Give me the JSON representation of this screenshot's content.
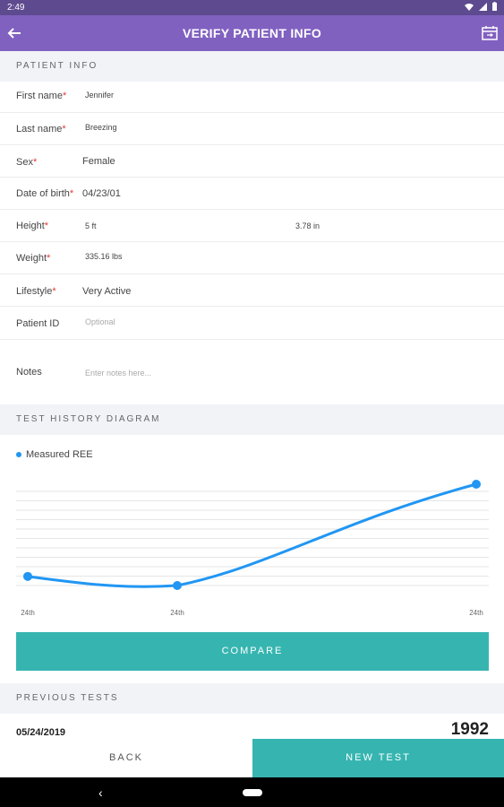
{
  "status_bar": {
    "time": "2:49",
    "wifi_icon": "wifi-icon",
    "battery_icon": "battery-icon"
  },
  "app_bar": {
    "title": "VERIFY PATIENT INFO",
    "back_icon": "back-arrow-icon",
    "calendar_icon": "calendar-icon",
    "color": "#8161c0"
  },
  "patient_info": {
    "header": "PATIENT INFO",
    "first_name": {
      "label": "First name",
      "required": "*",
      "value": "Jennifer"
    },
    "last_name": {
      "label": "Last name",
      "required": "*",
      "value": "Breezing"
    },
    "sex": {
      "label": "Sex",
      "required": "*",
      "value": "Female"
    },
    "dob": {
      "label": "Date of birth",
      "required": "*",
      "value": "04/23/01"
    },
    "height": {
      "label": "Height",
      "required": "*",
      "feet": "5 ft",
      "inches": "3.78 in"
    },
    "weight": {
      "label": "Weight",
      "required": "*",
      "value": "335.16 lbs"
    },
    "lifestyle": {
      "label": "Lifestyle",
      "required": "*",
      "value": "Very Active"
    },
    "patient_id": {
      "label": "Patient ID",
      "placeholder": "Optional"
    },
    "notes": {
      "label": "Notes",
      "placeholder": "Enter notes here..."
    }
  },
  "test_history": {
    "header": "TEST HISTORY DIAGRAM",
    "legend": "Measured REE",
    "compare_label": "COMPARE"
  },
  "chart_data": {
    "type": "line",
    "x": [
      "24th",
      "24th",
      "24th"
    ],
    "series": [
      {
        "name": "Measured REE",
        "values": [
          0.09,
          0.0,
          1.0
        ]
      }
    ],
    "color": "#2196f3",
    "grid": true,
    "legend_position": "top-left"
  },
  "previous_tests": {
    "header": "PREVIOUS TESTS",
    "date": "05/24/2019",
    "value": "1992"
  },
  "bottom_bar": {
    "back_label": "BACK",
    "new_test_label": "NEW TEST",
    "accent": "#36b5b0"
  },
  "nav_bar": {
    "back_icon": "nav-back-icon",
    "home_icon": "nav-home-icon"
  }
}
